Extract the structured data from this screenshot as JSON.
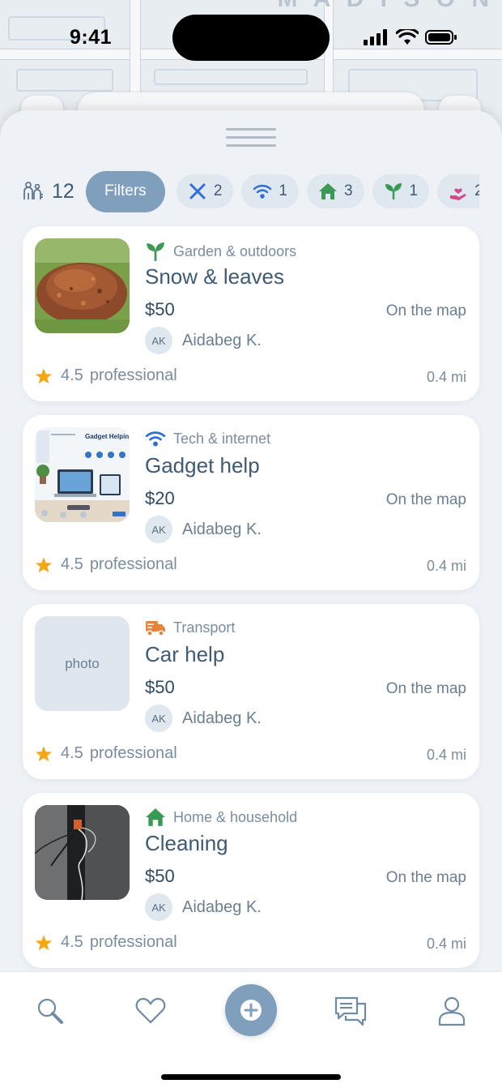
{
  "status_bar": {
    "time": "9:41"
  },
  "toolbar": {
    "people_count": "12",
    "filters_label": "Filters"
  },
  "chips": [
    {
      "icon": "tools-icon",
      "count": "2",
      "color": "#2f6fd6"
    },
    {
      "icon": "wifi-icon",
      "count": "1",
      "color": "#2f6fd6"
    },
    {
      "icon": "house-icon",
      "count": "3",
      "color": "#3a9a55"
    },
    {
      "icon": "sprout-icon",
      "count": "1",
      "color": "#3a9a55"
    },
    {
      "icon": "hand-heart-icon",
      "count": "2",
      "color": "#d24a8a"
    }
  ],
  "listings": [
    {
      "category": "Garden & outdoors",
      "category_icon": "sprout-icon",
      "title": "Snow & leaves",
      "price": "$50",
      "map_label": "On the map",
      "author_initials": "AK",
      "author_name": "Aidabeg K.",
      "rating": "4.5",
      "level": "professional",
      "distance": "0.4 mi",
      "photo": "leaves"
    },
    {
      "category": "Tech & internet",
      "category_icon": "wifi-icon",
      "title": "Gadget help",
      "price": "$20",
      "map_label": "On the map",
      "author_initials": "AK",
      "author_name": "Aidabeg K.",
      "rating": "4.5",
      "level": "professional",
      "distance": "0.4 mi",
      "photo": "gadget",
      "photo_text": "Gadget Helping Service"
    },
    {
      "category": "Transport",
      "category_icon": "truck-icon",
      "title": "Car help",
      "price": "$50",
      "map_label": "On the map",
      "author_initials": "AK",
      "author_name": "Aidabeg K.",
      "rating": "4.5",
      "level": "professional",
      "distance": "0.4 mi",
      "photo": "placeholder",
      "photo_placeholder": "photo"
    },
    {
      "category": "Home & household",
      "category_icon": "house-icon",
      "title": "Cleaning",
      "price": "$50",
      "map_label": "On the map",
      "author_initials": "AK",
      "author_name": "Aidabeg K.",
      "rating": "4.5",
      "level": "professional",
      "distance": "0.4 mi",
      "photo": "cables"
    }
  ],
  "colors": {
    "accent": "#7f9fbd",
    "text": "#3e5a74",
    "star": "#f3a712",
    "garden": "#3a9a55",
    "tech": "#2f6fd6",
    "transport": "#e8833a"
  }
}
